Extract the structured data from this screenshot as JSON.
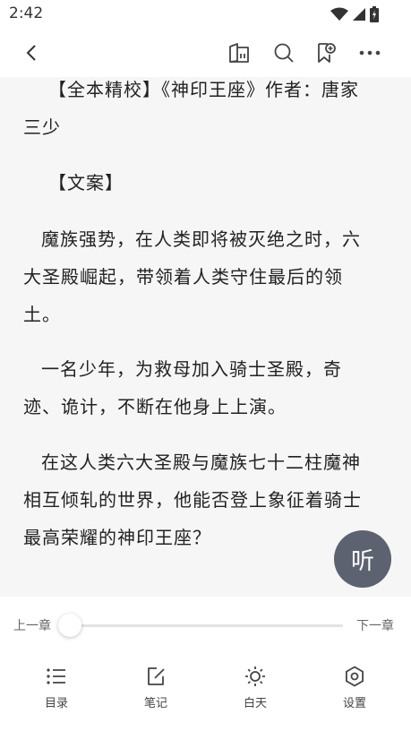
{
  "status_bar": {
    "time": "2:42"
  },
  "toolbar": {
    "icons": [
      "back-icon",
      "book-detail-icon",
      "search-icon",
      "bookmark-icon",
      "more-icon"
    ]
  },
  "content": {
    "paragraphs": [
      "【全本精校】《神印王座》作者：唐家三少",
      "【文案】",
      "魔族强势，在人类即将被灭绝之时，六大圣殿崛起，带领着人类守住最后的领土。",
      "一名少年，为救母加入骑士圣殿，奇迹、诡计，不断在他身上上演。",
      "在这人类六大圣殿与魔族七十二柱魔神相互倾轧的世界，他能否登上象征着骑士最高荣耀的神印王座？"
    ]
  },
  "listen_button": {
    "label": "听"
  },
  "chapter_nav": {
    "prev_label": "上一章",
    "next_label": "下一章",
    "progress": 0
  },
  "bottom_nav": {
    "items": [
      {
        "label": "目录",
        "icon": "catalog-icon"
      },
      {
        "label": "笔记",
        "icon": "note-icon"
      },
      {
        "label": "白天",
        "icon": "sun-icon"
      },
      {
        "label": "设置",
        "icon": "settings-icon"
      }
    ]
  },
  "colors": {
    "reader_bg": "#f6f6f6",
    "listen_button_bg": "#5c6270",
    "panel_bg": "#ffffff"
  }
}
